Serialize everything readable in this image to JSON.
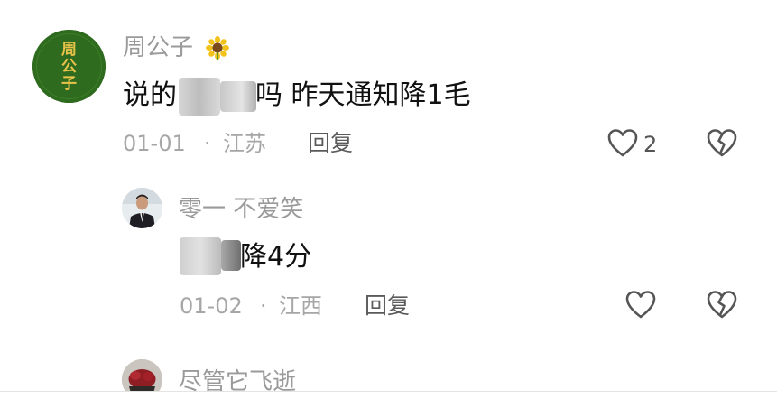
{
  "comments": [
    {
      "username": "周公子",
      "username_emoji": "sunflower-icon",
      "avatar_text": "周公子",
      "text_before": "说的",
      "text_after": "吗 昨天通知降1毛",
      "date": "01-01",
      "separator": "·",
      "location": "江苏",
      "reply_label": "回复",
      "like_count": "2",
      "replies": [
        {
          "username": "零一 不爱笑",
          "text_after": "降4分",
          "date": "01-02",
          "separator": "·",
          "location": "江西",
          "reply_label": "回复"
        }
      ]
    },
    {
      "username": "尽管它飞逝"
    }
  ],
  "colors": {
    "username": "#9a9a9a",
    "comment_text": "#111111",
    "meta": "#a6a6a6",
    "avatar_main_bg": "#2f6b1e",
    "avatar_text": "#e8c34a"
  }
}
